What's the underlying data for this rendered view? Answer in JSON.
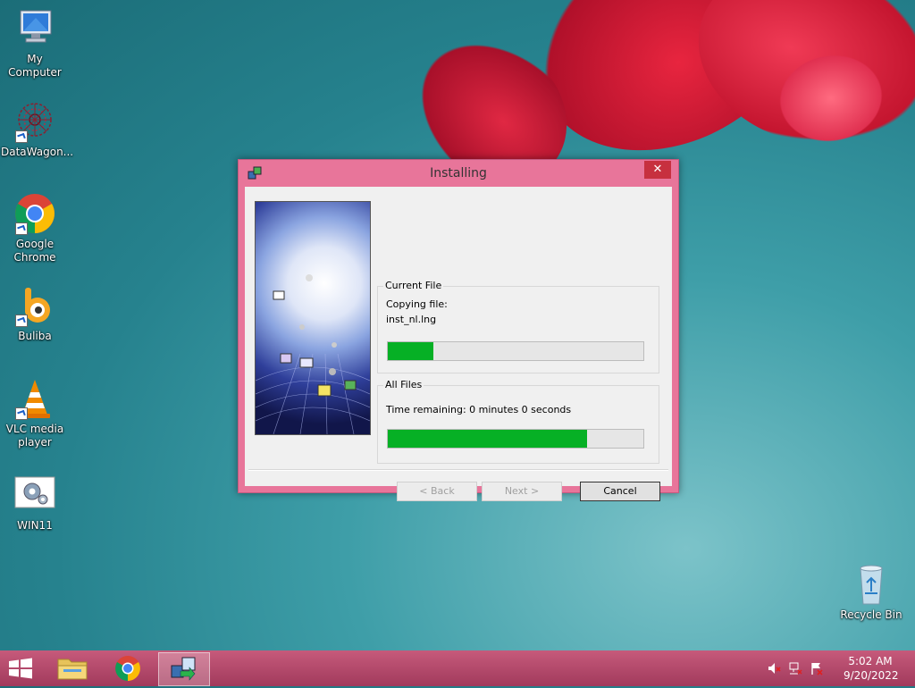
{
  "desktop": {
    "icons": [
      {
        "label": "My Computer"
      },
      {
        "label": "DataWagon..."
      },
      {
        "label": "Google Chrome"
      },
      {
        "label": "Buliba"
      },
      {
        "label": "VLC media player"
      },
      {
        "label": "WIN11"
      },
      {
        "label": "Recycle Bin"
      }
    ]
  },
  "dialog": {
    "title": "Installing",
    "close_glyph": "✕",
    "current_file": {
      "group_label": "Current File",
      "status": "Copying file:",
      "filename": "inst_nl.lng",
      "progress": 0.18
    },
    "all_files": {
      "group_label": "All Files",
      "time_remaining": "Time remaining: 0 minutes 0 seconds",
      "progress": 0.78
    },
    "buttons": {
      "back": "< Back",
      "next": "Next >",
      "cancel": "Cancel"
    }
  },
  "taskbar": {
    "items": [
      "windows-start-icon",
      "file-explorer-icon",
      "chrome-icon",
      "installer-icon"
    ],
    "active_item": "installer-icon"
  },
  "tray": {
    "time": "5:02 AM",
    "date": "9/20/2022"
  },
  "colors": {
    "window_frame": "#e8759a",
    "close_button": "#c7303f",
    "progress_fill": "#06b025",
    "taskbar": "#b14a6a"
  }
}
